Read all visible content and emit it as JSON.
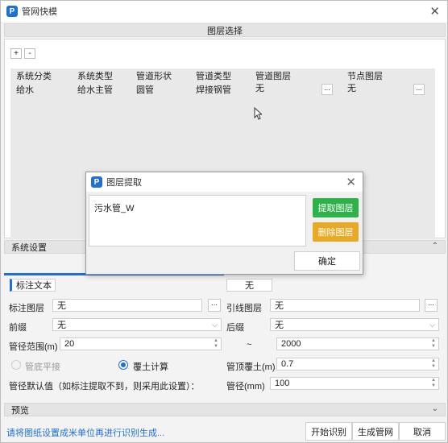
{
  "window": {
    "title": "管网快模",
    "logo_letter": "P",
    "close_glyph": "✕"
  },
  "layer_select": {
    "header": "图层选择",
    "add_label": "+",
    "remove_label": "-",
    "columns": [
      "系统分类",
      "系统类型",
      "管道形状",
      "管道类型",
      "管道图层",
      "节点图层"
    ],
    "rows": [
      {
        "category": "给水",
        "type": "给水主管",
        "shape": "圆管",
        "pipe_type": "焊接钢管",
        "pipe_layer": "无",
        "node_layer": "无"
      }
    ],
    "dots": "..."
  },
  "dialog": {
    "title": "图层提取",
    "text": "污水管_W",
    "extract_label": "提取图层",
    "delete_label": "删除图层",
    "ok_label": "确定",
    "extract_color": "#2db24a",
    "delete_color": "#e8a925"
  },
  "system_settings": {
    "header": "系统设置",
    "chevron": "⌃",
    "tab_label": "标注文本",
    "tab_value": "无",
    "label_layer_label": "标注图层",
    "label_layer_value": "无",
    "lead_layer_label": "引线图层",
    "lead_layer_value": "无",
    "prefix_label": "前缀",
    "prefix_value": "无",
    "suffix_label": "后缀",
    "suffix_value": "无",
    "diam_range_label": "管径范围(m)",
    "diam_min": "20",
    "tilde": "~",
    "diam_max": "2000",
    "radio_bottom_label": "管底平接",
    "radio_cover_label": "覆土计算",
    "top_cover_label": "管顶覆土(m)",
    "top_cover_value": "0.7",
    "default_diam_label": "管径默认值（如标注提取不到，则采用此设置）：",
    "diam_mm_label": "管径(mm)",
    "diam_mm_value": "100",
    "dots": "...",
    "accent": "#1e6fd9"
  },
  "preview": {
    "header": "预览",
    "chevron": "⌄"
  },
  "footer": {
    "hint": "请将图纸设置成米单位再进行识别生成...",
    "hint_color": "#1e6fd9",
    "start_label": "开始识别",
    "generate_label": "生成管网",
    "cancel_label": "取消"
  }
}
